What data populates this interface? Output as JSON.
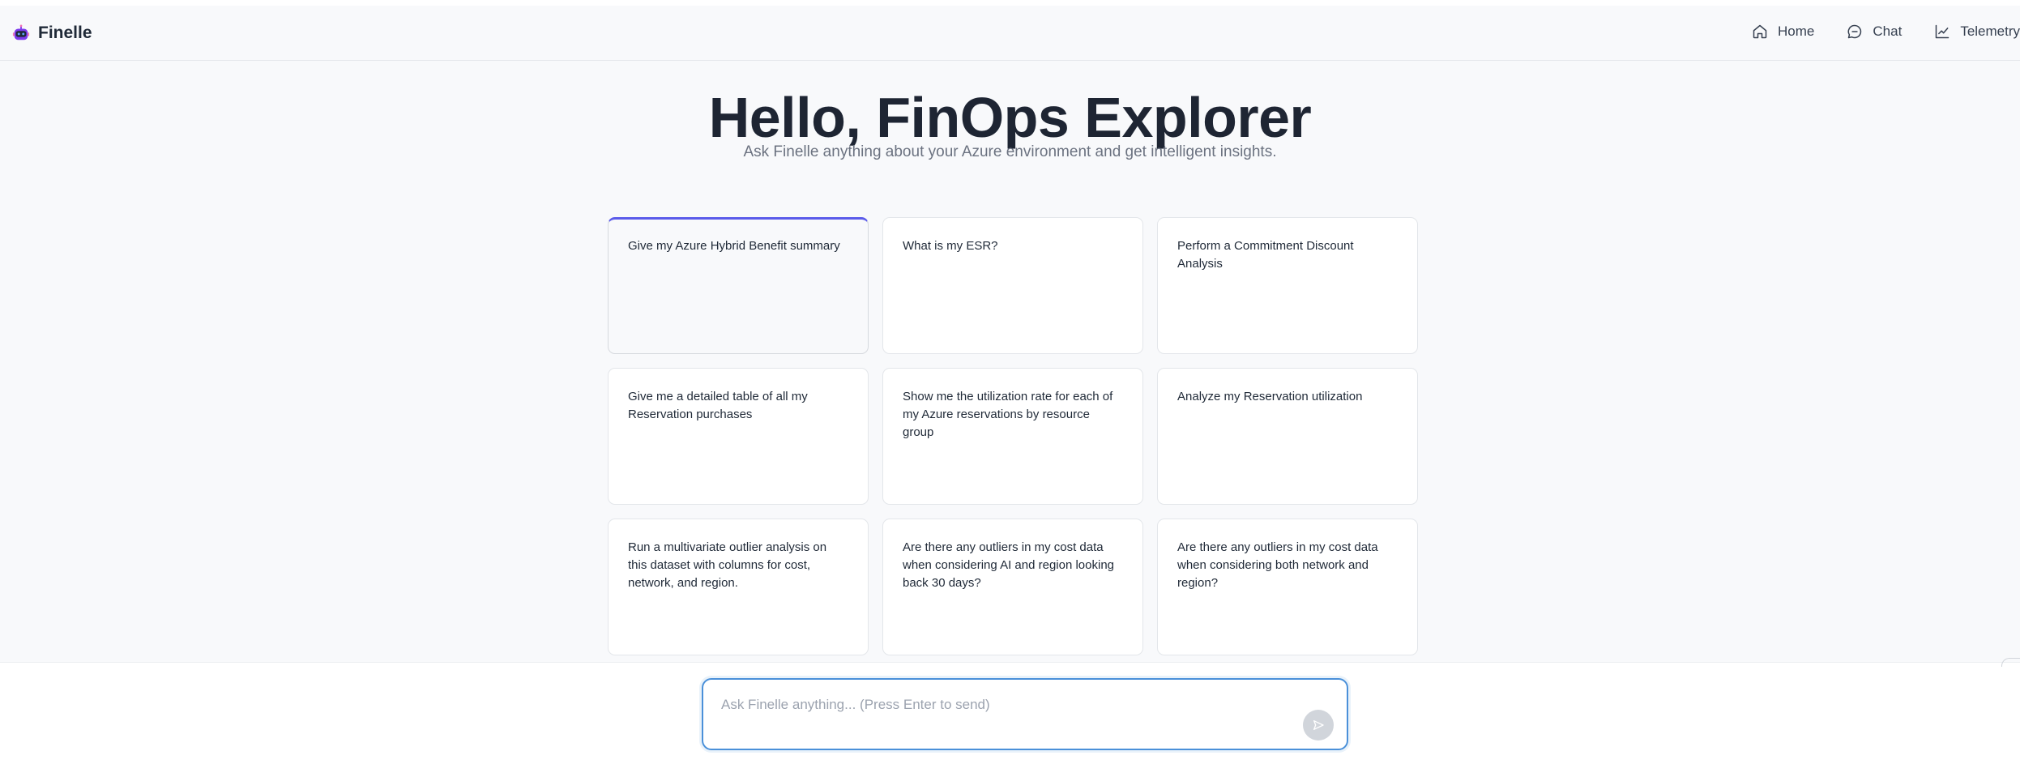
{
  "app": {
    "name": "Finelle",
    "logo_icon": "robot-mascot-icon"
  },
  "nav": {
    "items": [
      {
        "label": "Home",
        "icon": "home-icon"
      },
      {
        "label": "Chat",
        "icon": "chat-bubble-icon"
      },
      {
        "label": "Telemetry",
        "icon": "trend-chart-icon"
      }
    ]
  },
  "hero": {
    "title": "Hello, FinOps Explorer",
    "subtitle": "Ask Finelle anything about your Azure environment and get intelligent insights."
  },
  "suggestions": [
    {
      "text": "Give my Azure Hybrid Benefit summary",
      "active": true
    },
    {
      "text": "What is my ESR?"
    },
    {
      "text": "Perform a Commitment Discount Analysis"
    },
    {
      "text": "Give me a detailed table of all my Reservation purchases"
    },
    {
      "text": "Show me the utilization rate for each of my Azure reservations by resource group"
    },
    {
      "text": "Analyze my Reservation utilization"
    },
    {
      "text": "Run a multivariate outlier analysis on this dataset with columns for cost, network, and region."
    },
    {
      "text": "Are there any outliers in my cost data when considering AI and region looking back 30 days?"
    },
    {
      "text": "Are there any outliers in my cost data when considering both network and region?"
    }
  ],
  "chat": {
    "placeholder": "Ask Finelle anything... (Press Enter to send)",
    "value": "",
    "send_icon": "send-arrow-icon"
  },
  "colors": {
    "accent": "#5b5bea",
    "input_border": "#4a90d9",
    "background": "#f8f9fb"
  }
}
